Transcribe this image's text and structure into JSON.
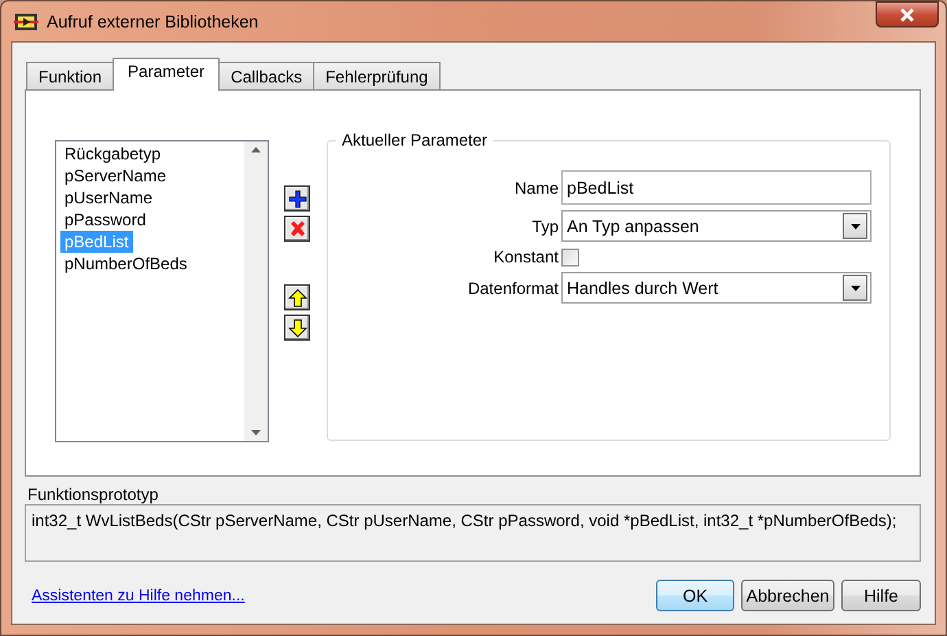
{
  "window": {
    "title": "Aufruf externer Bibliotheken"
  },
  "tabs": [
    {
      "label": "Funktion",
      "selected": false
    },
    {
      "label": "Parameter",
      "selected": true
    },
    {
      "label": "Callbacks",
      "selected": false
    },
    {
      "label": "Fehlerprüfung",
      "selected": false
    }
  ],
  "parameters": [
    {
      "label": "Rückgabetyp",
      "selected": false
    },
    {
      "label": "pServerName",
      "selected": false
    },
    {
      "label": "pUserName",
      "selected": false
    },
    {
      "label": "pPassword",
      "selected": false
    },
    {
      "label": "pBedList",
      "selected": true
    },
    {
      "label": "pNumberOfBeds",
      "selected": false
    }
  ],
  "group": {
    "title": "Aktueller Parameter",
    "fields": [
      {
        "kind": "text",
        "label": "Name",
        "value": "pBedList"
      },
      {
        "kind": "dropdown",
        "label": "Typ",
        "value": "An Typ anpassen"
      },
      {
        "kind": "checkbox",
        "label": "Konstant",
        "checked": false
      },
      {
        "kind": "dropdown",
        "label": "Datenformat",
        "value": "Handles durch Wert"
      }
    ]
  },
  "prototype": {
    "label": "Funktionsprototyp",
    "text": "int32_t WvListBeds(CStr pServerName, CStr pUserName, CStr pPassword, void *pBedList, int32_t *pNumberOfBeds);"
  },
  "link": "Assistenten zu Hilfe nehmen...",
  "buttons": [
    {
      "label": "OK",
      "default": true
    },
    {
      "label": "Abbrechen",
      "default": false
    },
    {
      "label": "Hilfe",
      "default": false
    }
  ]
}
